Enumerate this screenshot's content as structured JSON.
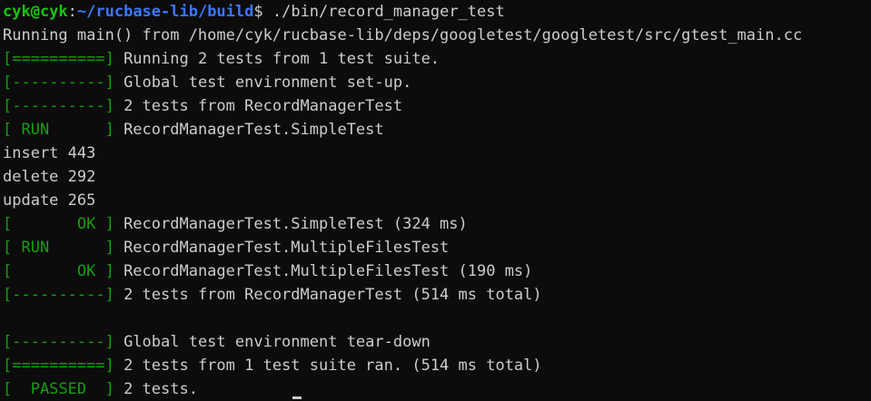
{
  "prompt": {
    "user_host": "cyk@cyk",
    "separator": ":",
    "path": "~/rucbase-lib/build",
    "symbol": "$",
    "command": " ./bin/record_manager_test"
  },
  "running_main": "Running main() from /home/cyk/rucbase-lib/deps/googletest/googletest/src/gtest_main.cc",
  "lines": [
    {
      "tag": "[==========]",
      "text": " Running 2 tests from 1 test suite."
    },
    {
      "tag": "[----------]",
      "text": " Global test environment set-up."
    },
    {
      "tag": "[----------]",
      "text": " 2 tests from RecordManagerTest"
    },
    {
      "tag": "[ RUN      ]",
      "text": " RecordManagerTest.SimpleTest"
    },
    {
      "plain": "insert 443"
    },
    {
      "plain": "delete 292"
    },
    {
      "plain": "update 265"
    },
    {
      "tag": "[       OK ]",
      "text": " RecordManagerTest.SimpleTest (324 ms)"
    },
    {
      "tag": "[ RUN      ]",
      "text": " RecordManagerTest.MultipleFilesTest"
    },
    {
      "tag": "[       OK ]",
      "text": " RecordManagerTest.MultipleFilesTest (190 ms)"
    },
    {
      "tag": "[----------]",
      "text": " 2 tests from RecordManagerTest (514 ms total)"
    },
    {
      "plain": ""
    },
    {
      "tag": "[----------]",
      "text": " Global test environment tear-down"
    },
    {
      "tag": "[==========]",
      "text": " 2 tests from 1 test suite ran. (514 ms total)"
    },
    {
      "tag": "[  PASSED  ]",
      "text": " 2 tests."
    }
  ],
  "colors": {
    "background": "#0c0c0c",
    "foreground": "#cccccc",
    "green": "#13a10e",
    "bright_green": "#16c60c",
    "blue": "#3b78ff"
  }
}
